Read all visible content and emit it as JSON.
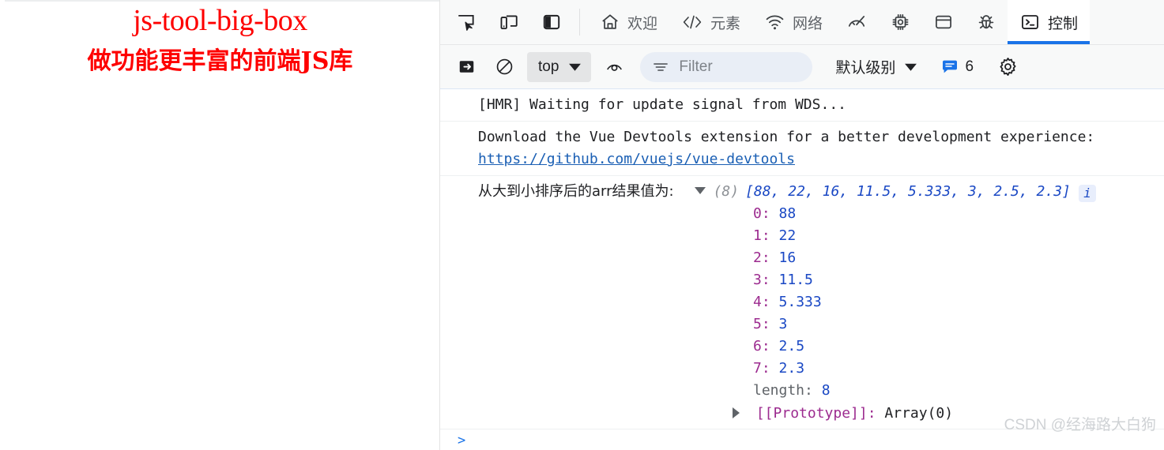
{
  "page": {
    "title_main": "js-tool-big-box",
    "title_sub": "做功能更丰富的前端JS库",
    "title_color": "#fe0000"
  },
  "devtools": {
    "accent_color": "#1a73e8",
    "toolbar_icons": [
      {
        "name": "inspect-element-icon",
        "tooltip": "检查元素"
      },
      {
        "name": "device-toolbar-icon",
        "tooltip": "切换设备工具栏"
      },
      {
        "name": "dock-side-icon",
        "tooltip": "停靠位置"
      }
    ],
    "tabs": [
      {
        "label": "欢迎",
        "icon": "home-icon",
        "active": false
      },
      {
        "label": "元素",
        "icon": "code-brackets-icon",
        "active": false
      },
      {
        "label": "网络",
        "icon": "wifi-icon",
        "active": false
      },
      {
        "label": "",
        "icon": "performance-gauge-icon",
        "active": false
      },
      {
        "label": "",
        "icon": "memory-chip-icon",
        "active": false
      },
      {
        "label": "",
        "icon": "application-storage-icon",
        "active": false
      },
      {
        "label": "",
        "icon": "bug-icon",
        "active": false
      },
      {
        "label": "控制",
        "icon": "console-terminal-icon",
        "active": true
      }
    ],
    "console_toolbar": {
      "sidebar_toggle": "console-sidebar-icon",
      "clear_console": "clear-console-icon",
      "context_value": "top",
      "live_expression": "eye-icon",
      "filter_placeholder": "Filter",
      "filter_value": "",
      "level_value": "默认级别",
      "message_count": "6",
      "settings": "gear-icon"
    },
    "messages": [
      {
        "type": "text",
        "text": "[HMR] Waiting for update signal from WDS..."
      },
      {
        "type": "link",
        "text": "Download the Vue Devtools extension for a better development experience:",
        "link": "https://github.com/vuejs/vue-devtools"
      }
    ],
    "object_log": {
      "label": "从大到小排序后的arr结果值为:",
      "count": "(8)",
      "preview": "[88, 22, 16, 11.5, 5.333, 3, 2.5, 2.3]",
      "badge": "i",
      "expanded": true,
      "props": [
        {
          "key": "0",
          "value": "88"
        },
        {
          "key": "1",
          "value": "22"
        },
        {
          "key": "2",
          "value": "16"
        },
        {
          "key": "3",
          "value": "11.5"
        },
        {
          "key": "4",
          "value": "5.333"
        },
        {
          "key": "5",
          "value": "3"
        },
        {
          "key": "6",
          "value": "2.5"
        },
        {
          "key": "7",
          "value": "2.3"
        }
      ],
      "length_key": "length:",
      "length_value": "8",
      "proto_key": "[[Prototype]]:",
      "proto_value": "Array(0)"
    },
    "prompt_caret": ">"
  },
  "watermark": "CSDN @经海路大白狗"
}
